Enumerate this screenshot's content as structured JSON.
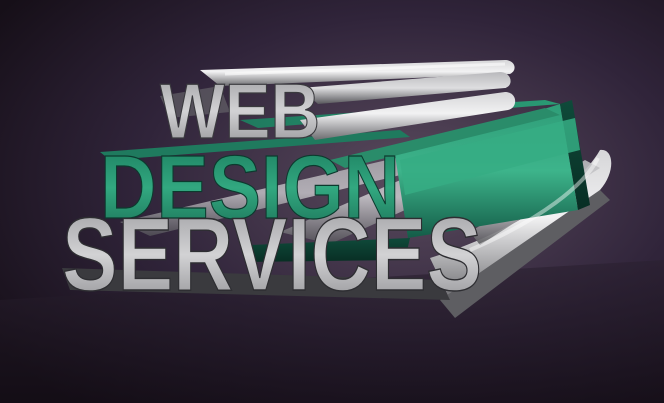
{
  "headline": {
    "line1": "WEB",
    "line2": "DESIGN",
    "line3": "SERVICES"
  },
  "colors": {
    "background_light": "#5a4b5e",
    "background_dark": "#160f18",
    "letter_grey_light": "#e6e6e8",
    "letter_grey_dark": "#6e6e72",
    "accent_green_light": "#3cb58c",
    "accent_green_dark": "#145c48"
  }
}
